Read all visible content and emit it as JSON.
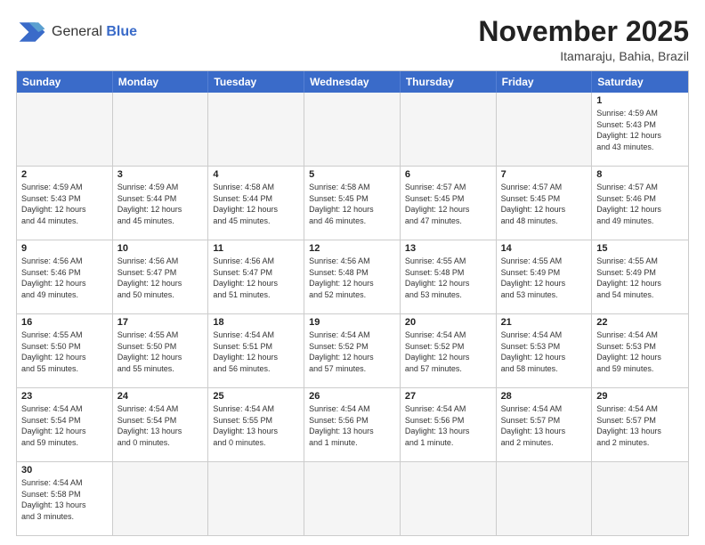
{
  "logo": {
    "line1": "General",
    "line2": "Blue"
  },
  "title": "November 2025",
  "location": "Itamaraju, Bahia, Brazil",
  "days_of_week": [
    "Sunday",
    "Monday",
    "Tuesday",
    "Wednesday",
    "Thursday",
    "Friday",
    "Saturday"
  ],
  "weeks": [
    [
      {
        "day": "",
        "info": ""
      },
      {
        "day": "",
        "info": ""
      },
      {
        "day": "",
        "info": ""
      },
      {
        "day": "",
        "info": ""
      },
      {
        "day": "",
        "info": ""
      },
      {
        "day": "",
        "info": ""
      },
      {
        "day": "1",
        "info": "Sunrise: 4:59 AM\nSunset: 5:43 PM\nDaylight: 12 hours\nand 43 minutes."
      }
    ],
    [
      {
        "day": "2",
        "info": "Sunrise: 4:59 AM\nSunset: 5:43 PM\nDaylight: 12 hours\nand 44 minutes."
      },
      {
        "day": "3",
        "info": "Sunrise: 4:59 AM\nSunset: 5:44 PM\nDaylight: 12 hours\nand 45 minutes."
      },
      {
        "day": "4",
        "info": "Sunrise: 4:58 AM\nSunset: 5:44 PM\nDaylight: 12 hours\nand 45 minutes."
      },
      {
        "day": "5",
        "info": "Sunrise: 4:58 AM\nSunset: 5:45 PM\nDaylight: 12 hours\nand 46 minutes."
      },
      {
        "day": "6",
        "info": "Sunrise: 4:57 AM\nSunset: 5:45 PM\nDaylight: 12 hours\nand 47 minutes."
      },
      {
        "day": "7",
        "info": "Sunrise: 4:57 AM\nSunset: 5:45 PM\nDaylight: 12 hours\nand 48 minutes."
      },
      {
        "day": "8",
        "info": "Sunrise: 4:57 AM\nSunset: 5:46 PM\nDaylight: 12 hours\nand 49 minutes."
      }
    ],
    [
      {
        "day": "9",
        "info": "Sunrise: 4:56 AM\nSunset: 5:46 PM\nDaylight: 12 hours\nand 49 minutes."
      },
      {
        "day": "10",
        "info": "Sunrise: 4:56 AM\nSunset: 5:47 PM\nDaylight: 12 hours\nand 50 minutes."
      },
      {
        "day": "11",
        "info": "Sunrise: 4:56 AM\nSunset: 5:47 PM\nDaylight: 12 hours\nand 51 minutes."
      },
      {
        "day": "12",
        "info": "Sunrise: 4:56 AM\nSunset: 5:48 PM\nDaylight: 12 hours\nand 52 minutes."
      },
      {
        "day": "13",
        "info": "Sunrise: 4:55 AM\nSunset: 5:48 PM\nDaylight: 12 hours\nand 53 minutes."
      },
      {
        "day": "14",
        "info": "Sunrise: 4:55 AM\nSunset: 5:49 PM\nDaylight: 12 hours\nand 53 minutes."
      },
      {
        "day": "15",
        "info": "Sunrise: 4:55 AM\nSunset: 5:49 PM\nDaylight: 12 hours\nand 54 minutes."
      }
    ],
    [
      {
        "day": "16",
        "info": "Sunrise: 4:55 AM\nSunset: 5:50 PM\nDaylight: 12 hours\nand 55 minutes."
      },
      {
        "day": "17",
        "info": "Sunrise: 4:55 AM\nSunset: 5:50 PM\nDaylight: 12 hours\nand 55 minutes."
      },
      {
        "day": "18",
        "info": "Sunrise: 4:54 AM\nSunset: 5:51 PM\nDaylight: 12 hours\nand 56 minutes."
      },
      {
        "day": "19",
        "info": "Sunrise: 4:54 AM\nSunset: 5:52 PM\nDaylight: 12 hours\nand 57 minutes."
      },
      {
        "day": "20",
        "info": "Sunrise: 4:54 AM\nSunset: 5:52 PM\nDaylight: 12 hours\nand 57 minutes."
      },
      {
        "day": "21",
        "info": "Sunrise: 4:54 AM\nSunset: 5:53 PM\nDaylight: 12 hours\nand 58 minutes."
      },
      {
        "day": "22",
        "info": "Sunrise: 4:54 AM\nSunset: 5:53 PM\nDaylight: 12 hours\nand 59 minutes."
      }
    ],
    [
      {
        "day": "23",
        "info": "Sunrise: 4:54 AM\nSunset: 5:54 PM\nDaylight: 12 hours\nand 59 minutes."
      },
      {
        "day": "24",
        "info": "Sunrise: 4:54 AM\nSunset: 5:54 PM\nDaylight: 13 hours\nand 0 minutes."
      },
      {
        "day": "25",
        "info": "Sunrise: 4:54 AM\nSunset: 5:55 PM\nDaylight: 13 hours\nand 0 minutes."
      },
      {
        "day": "26",
        "info": "Sunrise: 4:54 AM\nSunset: 5:56 PM\nDaylight: 13 hours\nand 1 minute."
      },
      {
        "day": "27",
        "info": "Sunrise: 4:54 AM\nSunset: 5:56 PM\nDaylight: 13 hours\nand 1 minute."
      },
      {
        "day": "28",
        "info": "Sunrise: 4:54 AM\nSunset: 5:57 PM\nDaylight: 13 hours\nand 2 minutes."
      },
      {
        "day": "29",
        "info": "Sunrise: 4:54 AM\nSunset: 5:57 PM\nDaylight: 13 hours\nand 2 minutes."
      }
    ],
    [
      {
        "day": "30",
        "info": "Sunrise: 4:54 AM\nSunset: 5:58 PM\nDaylight: 13 hours\nand 3 minutes."
      },
      {
        "day": "",
        "info": ""
      },
      {
        "day": "",
        "info": ""
      },
      {
        "day": "",
        "info": ""
      },
      {
        "day": "",
        "info": ""
      },
      {
        "day": "",
        "info": ""
      },
      {
        "day": "",
        "info": ""
      }
    ]
  ]
}
